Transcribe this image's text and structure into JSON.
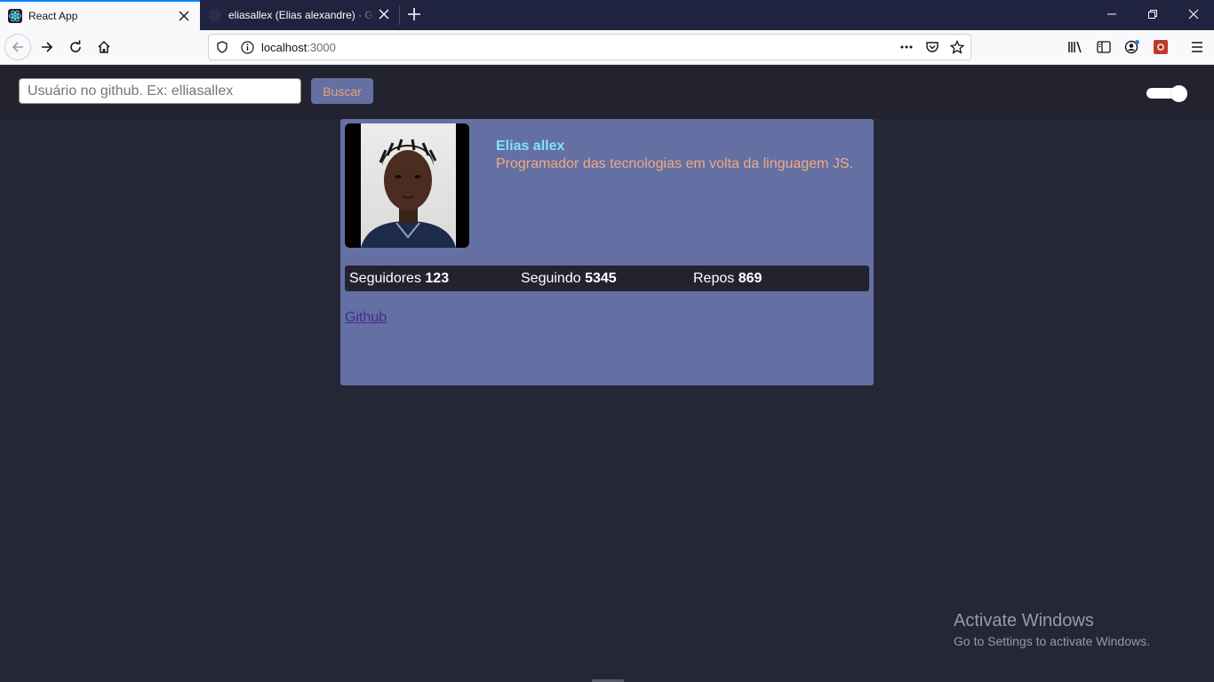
{
  "browser": {
    "tabs": [
      {
        "title": "React App",
        "active": true,
        "favicon": "react-icon"
      },
      {
        "title": "eliasallex (Elias alexandre) · GitHub",
        "active": false,
        "favicon": "github-icon"
      }
    ],
    "url": {
      "host": "localhost",
      "port": ":3000"
    }
  },
  "search": {
    "placeholder": "Usuário no github. Ex: elliasallex",
    "value": "",
    "button_label": "Buscar"
  },
  "theme_toggle": {
    "on": true
  },
  "profile": {
    "name": "Elias allex",
    "bio": "Programador das tecnologias em volta da linguagem JS.",
    "stats": [
      {
        "label": "Seguidores",
        "value": "123"
      },
      {
        "label": "Seguindo",
        "value": "5345"
      },
      {
        "label": "Repos",
        "value": "869"
      }
    ],
    "link_label": "Github"
  },
  "watermark": {
    "line1": "Activate Windows",
    "line2": "Go to Settings to activate Windows."
  },
  "colors": {
    "page_bg": "#252636",
    "card_bg": "#6470a3",
    "name": "#7fe3ff",
    "bio": "#f0a97e",
    "accent_tab": "#0a84ff"
  }
}
